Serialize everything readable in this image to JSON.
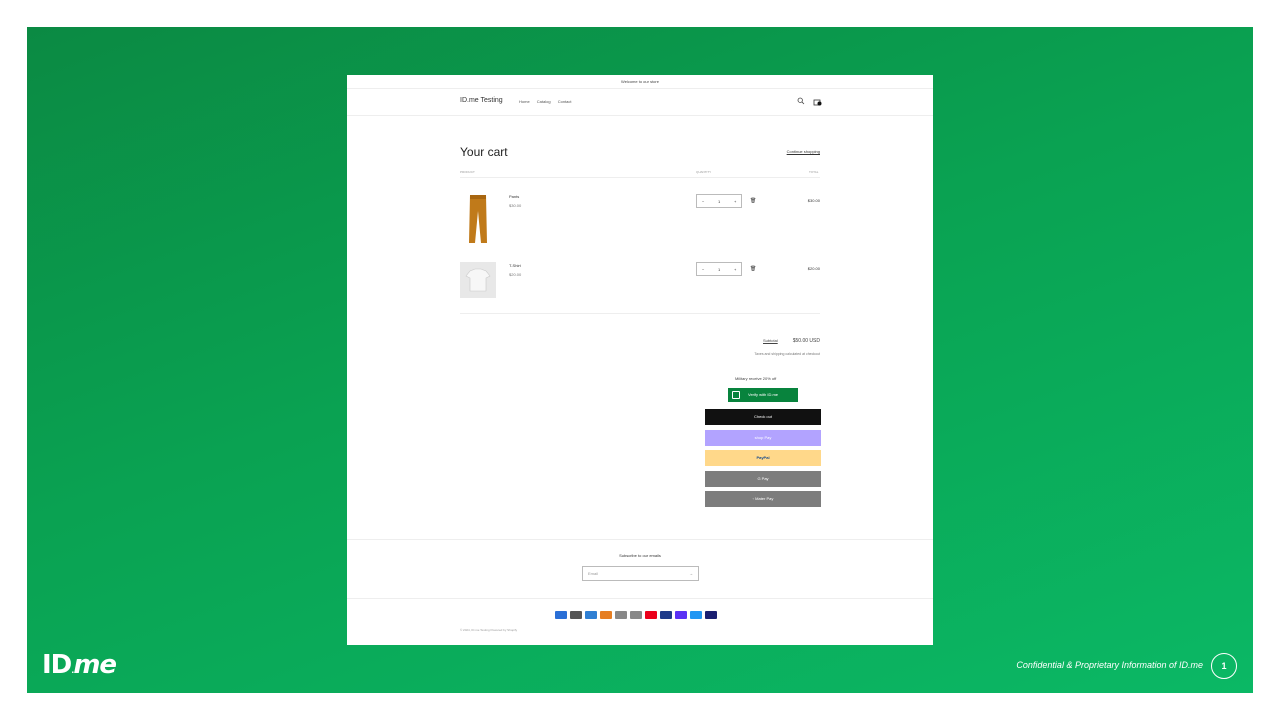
{
  "store": {
    "announcement": "Welcome to our store",
    "name": "ID.me Testing",
    "nav": [
      "Home",
      "Catalog",
      "Contact"
    ],
    "search_icon": "search-icon",
    "cart_icon": "bag-icon"
  },
  "cart": {
    "title": "Your cart",
    "continue": "Continue shopping",
    "columns": [
      "PRODUCT",
      "QUANTITY",
      "TOTAL"
    ],
    "items": [
      {
        "name": "Pants",
        "price": "$30.00",
        "qty": "1",
        "total": "$30.00",
        "image": "pants-image",
        "color": "#c07a1a"
      },
      {
        "name": "T-Shirt",
        "price": "$20.00",
        "qty": "1",
        "total": "$20.00",
        "image": "tshirt-image",
        "color": "#e9e9e9"
      }
    ],
    "subtotal_label": "Subtotal",
    "subtotal_value": "$50.00 USD",
    "tax_note": "Taxes and shipping calculated at checkout",
    "military_note": "Military receive 20% off",
    "verify_label": "Verify with ID.me",
    "checkout": "Check out",
    "shop_pay": "shop Pay",
    "paypal": "PayPal",
    "gpay": "G Pay",
    "mpay": "◦ Mater Pay"
  },
  "footer": {
    "subscribe": "Subscribe to our emails",
    "email_placeholder": "Email",
    "copyright": "© 2024, ID.me Testing Powered by Shopify",
    "payment_colors": [
      "#2a6fd6",
      "#555555",
      "#2f7fd3",
      "#e67e22",
      "#888888",
      "#888888",
      "#eb001b",
      "#1e3a8a",
      "#5a31f4",
      "#2196f3",
      "#1a1f71"
    ]
  },
  "slide": {
    "brand": "ID.me",
    "confidential": "Confidential & Proprietary Information of ID.me",
    "page": "1"
  }
}
